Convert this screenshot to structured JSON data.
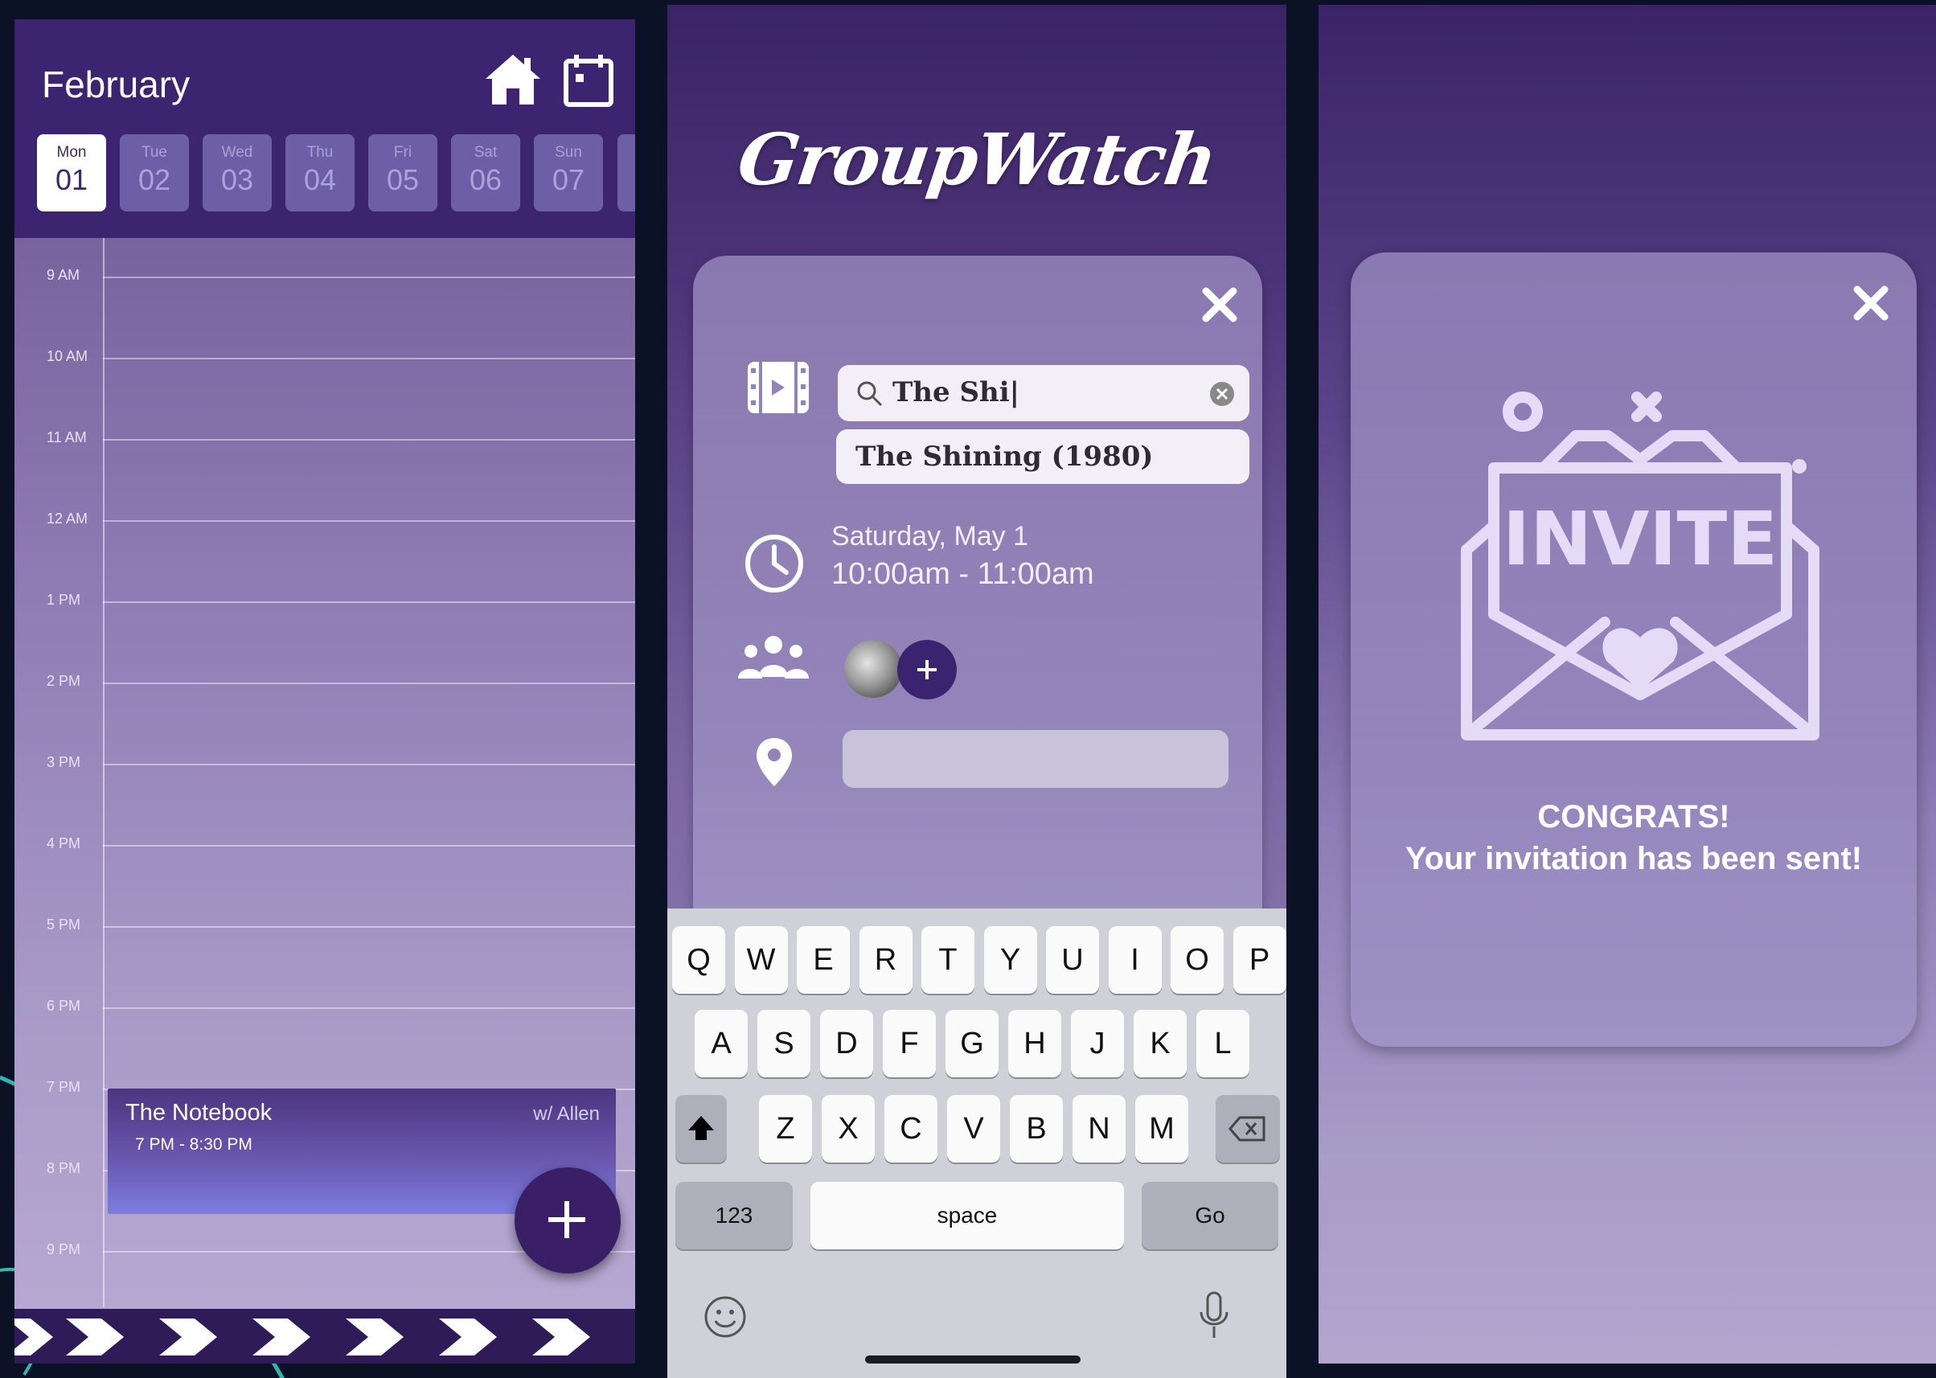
{
  "calendar": {
    "month": "February",
    "days": [
      {
        "name": "Mon",
        "num": "01"
      },
      {
        "name": "Tue",
        "num": "02"
      },
      {
        "name": "Wed",
        "num": "03"
      },
      {
        "name": "Thu",
        "num": "04"
      },
      {
        "name": "Fri",
        "num": "05"
      },
      {
        "name": "Sat",
        "num": "06"
      },
      {
        "name": "Sun",
        "num": "07"
      }
    ],
    "times": [
      "9 AM",
      "10 AM",
      "11 AM",
      "12 AM",
      "1 PM",
      "2 PM",
      "3 PM",
      "4 PM",
      "5 PM",
      "6 PM",
      "7 PM",
      "8 PM",
      "9 PM"
    ],
    "event": {
      "title": "The Notebook",
      "with": "w/ Allen",
      "time": "7 PM - 8:30 PM"
    }
  },
  "form": {
    "logo": "GroupWatch",
    "search_value": "The Shi|",
    "suggestion": "The Shining (1980)",
    "date": "Saturday, May 1",
    "time": "10:00am - 11:00am"
  },
  "keyboard": {
    "row1": [
      "Q",
      "W",
      "E",
      "R",
      "T",
      "Y",
      "U",
      "I",
      "O",
      "P"
    ],
    "row2": [
      "A",
      "S",
      "D",
      "F",
      "G",
      "H",
      "J",
      "K",
      "L"
    ],
    "row3": [
      "Z",
      "X",
      "C",
      "V",
      "B",
      "N",
      "M"
    ],
    "numbers": "123",
    "space": "space",
    "go": "Go"
  },
  "confirm": {
    "invite_word": "INVITE",
    "line1": "CONGRATS!",
    "line2": "Your invitation has been sent!"
  }
}
